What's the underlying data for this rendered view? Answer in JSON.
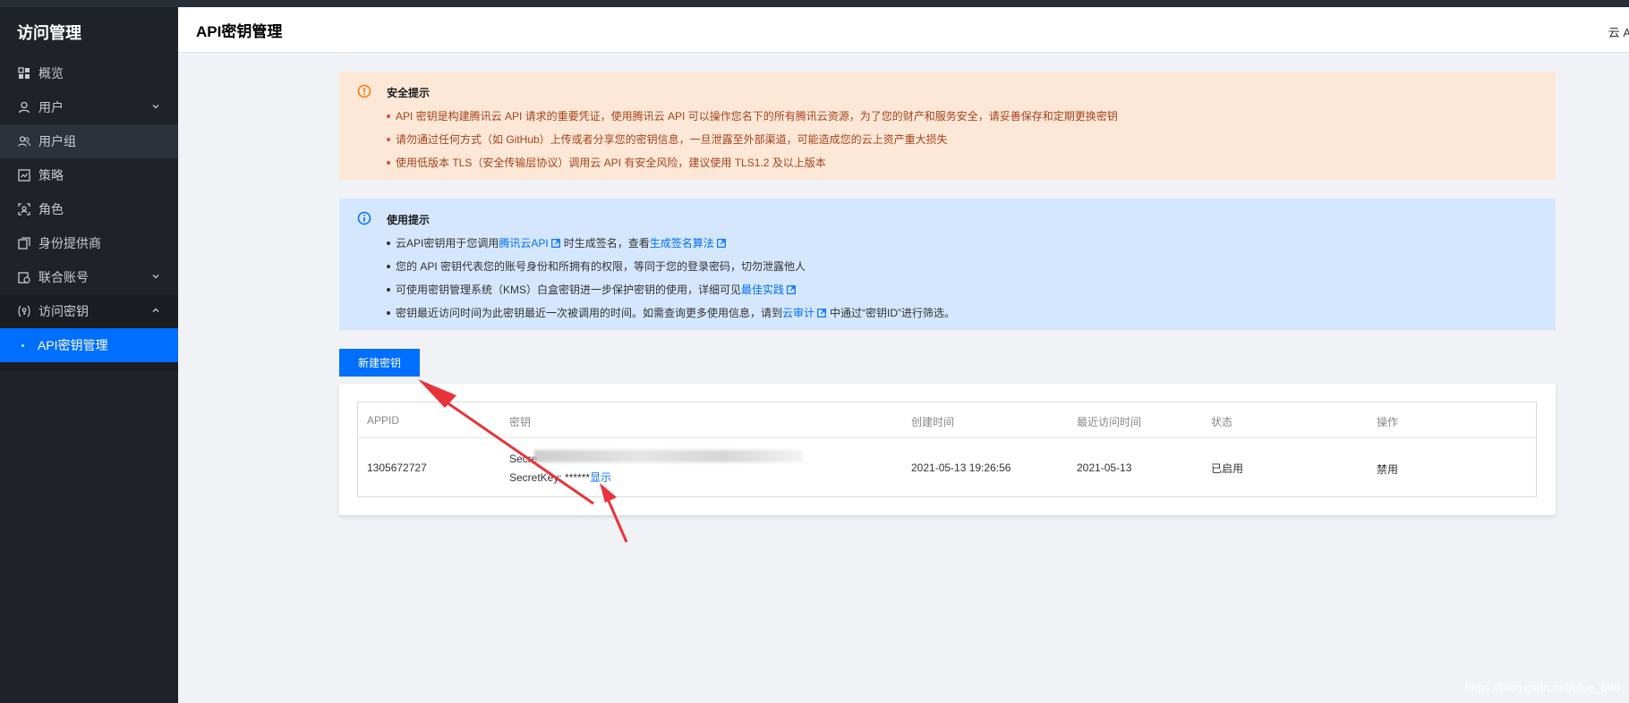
{
  "colors": {
    "sidebar_bg": "#1f2329",
    "accent": "#006eff",
    "warn_bg": "#fde8d8",
    "info_bg": "#d5e7ff",
    "status_enabled": "#0abf5b",
    "annotation_arrow": "#e8333a"
  },
  "sidebar": {
    "title": "访问管理",
    "items": [
      {
        "label": "概览",
        "icon": "overview-grid-icon"
      },
      {
        "label": "用户",
        "icon": "user-icon",
        "expandable": true
      },
      {
        "label": "用户组",
        "icon": "user-group-icon"
      },
      {
        "label": "策略",
        "icon": "policy-icon"
      },
      {
        "label": "角色",
        "icon": "role-icon"
      },
      {
        "label": "身份提供商",
        "icon": "identity-provider-icon"
      },
      {
        "label": "联合账号",
        "icon": "federated-account-icon",
        "expandable": true
      },
      {
        "label": "访问密钥",
        "icon": "access-key-icon",
        "expandable": true,
        "expanded": true
      }
    ],
    "sub_item": {
      "label": "API密钥管理"
    }
  },
  "header": {
    "title": "API密钥管理",
    "right_text": "云 A"
  },
  "security_notice": {
    "title": "安全提示",
    "icon": "warning-circle-icon",
    "items": [
      "API 密钥是构建腾讯云 API 请求的重要凭证，使用腾讯云 API 可以操作您名下的所有腾讯云资源，为了您的财产和服务安全，请妥善保存和定期更换密钥",
      "请勿通过任何方式（如 GitHub）上传或者分享您的密钥信息，一旦泄露至外部渠道，可能造成您的云上资产重大损失",
      "使用低版本 TLS（安全传输层协议）调用云 API 有安全风险，建议使用 TLS1.2 及以上版本"
    ]
  },
  "usage_notice": {
    "title": "使用提示",
    "icon": "info-circle-icon",
    "line1": {
      "a": "云API密钥用于您调用",
      "link1": "腾讯云API",
      "b": "时生成签名，查看",
      "link2": "生成签名算法"
    },
    "line2": "您的 API 密钥代表您的账号身份和所拥有的权限，等同于您的登录密码，切勿泄露他人",
    "line3": {
      "a": "可使用密钥管理系统（KMS）白盒密钥进一步保护密钥的使用，详细可见",
      "link": "最佳实践"
    },
    "line4": {
      "a": "密钥最近访问时间为此密钥最近一次被调用的时间。如需查询更多使用信息，请到",
      "link": "云审计",
      "b": "中通过“密钥ID”进行筛选。"
    }
  },
  "create_button": "新建密钥",
  "table": {
    "columns": [
      "APPID",
      "密钥",
      "创建时间",
      "最近访问时间",
      "状态",
      "操作"
    ],
    "rows": [
      {
        "appid": "1305672727",
        "secret_id_label": "Secre",
        "secret_key_label": "SecretKey:",
        "secret_key_mask": "******",
        "show_link": "显示",
        "created": "2021-05-13 19:26:56",
        "last_access": "2021-05-13",
        "status": "已启用",
        "action": "禁用"
      }
    ]
  },
  "watermark": "https://blog.csdn.net/blue_698"
}
